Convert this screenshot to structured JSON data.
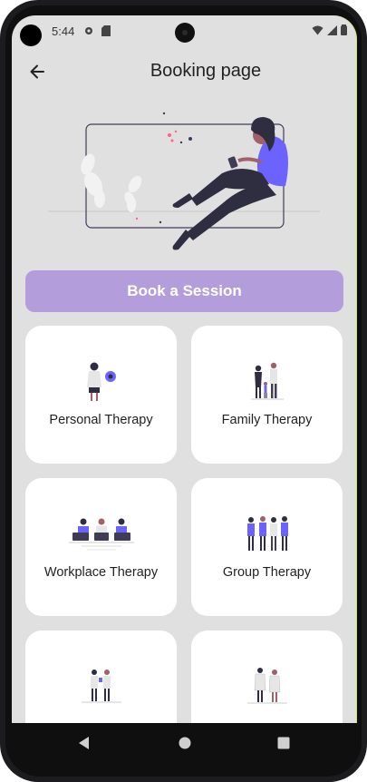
{
  "status_bar": {
    "time": "5:44",
    "icons": [
      "gear-icon",
      "sd-card-icon",
      "wifi-icon",
      "signal-icon",
      "battery-icon"
    ]
  },
  "header": {
    "title": "Booking page",
    "back_icon": "arrow-left-icon"
  },
  "cta": {
    "label": "Book a Session"
  },
  "categories": [
    {
      "label": "Personal Therapy"
    },
    {
      "label": "Family Therapy"
    },
    {
      "label": "Workplace Therapy"
    },
    {
      "label": "Group Therapy"
    },
    {
      "label": ""
    },
    {
      "label": ""
    }
  ],
  "colors": {
    "accent": "#b39ddb",
    "illustration": "#6c63ff",
    "screen_bg": "#e0e0e0",
    "card_bg": "#ffffff"
  },
  "nav": {
    "icons": [
      "back-triangle-icon",
      "home-circle-icon",
      "recents-square-icon"
    ]
  }
}
